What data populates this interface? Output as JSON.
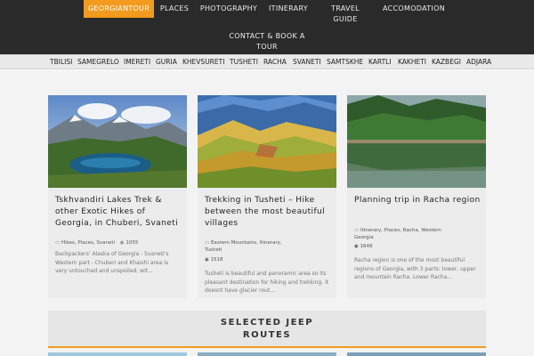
{
  "nav": {
    "items": [
      "GEORGIANTOUR",
      "PLACES",
      "PHOTOGRAPHY",
      "ITINERARY",
      "TRAVEL GUIDE",
      "ACCOMODATION",
      "CONTACT & BOOK A TOUR"
    ],
    "travel_line1": "TRAVEL",
    "travel_line2": "GUIDE",
    "contact_line1": "CONTACT & BOOK A",
    "contact_line2": "TOUR",
    "active": "GEORGIANTOUR",
    "accent_color": "#f29b1e"
  },
  "regions": [
    "TBILISI",
    "SAMEGRELO",
    "IMERETI",
    "GURIA",
    "KHEVSURETI",
    "TUSHETI",
    "RACHA",
    "SVANETI",
    "SAMTSKHE",
    "KARTLI",
    "KAKHETI",
    "KAZBEGI",
    "ADJARA"
  ],
  "cards": [
    {
      "title": "Tskhvandiri Lakes Trek & other Exotic Hikes of Georgia, in Chuberi, Svaneti",
      "categories": "Hikes, Places, Svaneti",
      "views": "1055",
      "excerpt": "Backpackers' Alaska of Georgia - Svaneti's Western part - Chuberi and Khaishi area is very untouched and unspoiled, wit..."
    },
    {
      "title": "Trekking in Tusheti – Hike between the most beautiful villages",
      "categories_line1": "Eastern Mountains, Itinerary,",
      "categories_line2": "Tusheti",
      "views": "1518",
      "excerpt": "Tusheti is beautiful and panoramic area so its pleasant destination for hiking and trekking. it doesnt have glacier rout..."
    },
    {
      "title": "Planning trip in Racha region",
      "categories_line1": "Itinerary, Places, Racha, Western",
      "categories_line2": "Georgia",
      "views": "1648",
      "excerpt": "Racha region is one of the most beautiful regions of Georgia, with 3 parts: lower, upper and mountain Racha. Lower Racha..."
    }
  ],
  "jeep": {
    "line1": "SELECTED JEEP",
    "line2": "ROUTES"
  },
  "icons": {
    "category": "folder-icon",
    "views": "eye-icon"
  }
}
